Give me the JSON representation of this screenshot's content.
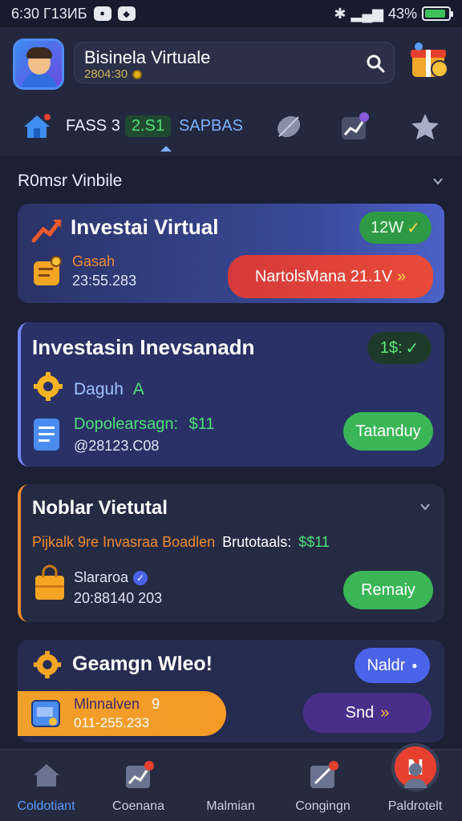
{
  "status": {
    "time": "6:30 Г13ИБ",
    "right_text": "43%",
    "battery_level": 0.9
  },
  "header": {
    "search_title": "Bisinela Virtuale",
    "search_sub": "2804:30",
    "tabs": {
      "label": "FASS 3",
      "number": "2.S1",
      "secondary": "SAPBAS"
    }
  },
  "main": {
    "section_title": "R0msr Vinbile",
    "card1": {
      "title": "Investai Virtual",
      "badge": "12W",
      "sub_label": "Gasah",
      "value": "23:55.283",
      "button": "NartolsMana 21.1V"
    },
    "card2": {
      "title": "Investasin Inevsanadn",
      "badge": "1$:",
      "sub_label": "Daguh",
      "sub_letter": "A",
      "detail_label": "Dopolearsagn:",
      "detail_amount": "$11",
      "value": "@28123.C08",
      "button": "Tatanduy"
    },
    "card3": {
      "title": "Noblar Vietutal",
      "line_orange": "Pijkalk 9re Invasraa Boadlen",
      "line_white": "Brutotaals:",
      "line_green": "$$11",
      "sub_label": "Slararoa",
      "value": "20:88140 203",
      "button": "Remaiy"
    },
    "card4": {
      "title": "Geamgn Wleo!",
      "button_blue": "Naldr",
      "orange_label": "Mlnnalven",
      "orange_num": "9",
      "orange_value": "011-255.233",
      "button_purple": "Snd"
    }
  },
  "nav": {
    "items": [
      {
        "label": "Coldotiant"
      },
      {
        "label": "Coenana"
      },
      {
        "label": "Malmian"
      },
      {
        "label": "Congingn"
      },
      {
        "label": "Paldrotelt"
      }
    ],
    "center_letter": "N"
  }
}
